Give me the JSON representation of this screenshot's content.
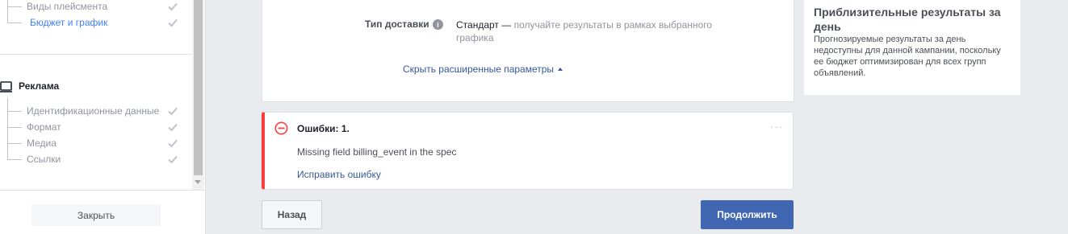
{
  "sidebar": {
    "campaign_items": [
      {
        "label": "Виды плейсмента",
        "active": false
      },
      {
        "label": "Бюджет и график",
        "active": true
      }
    ],
    "ad_section_title": "Реклама",
    "ad_items": [
      {
        "label": "Идентификационные данные"
      },
      {
        "label": "Формат"
      },
      {
        "label": "Медиа"
      },
      {
        "label": "Ссылки"
      }
    ],
    "close_label": "Закрыть"
  },
  "delivery": {
    "label": "Тип доставки",
    "value_main": "Стандарт —",
    "value_sub": "получайте результаты в рамках выбранного графика",
    "info_glyph": "i"
  },
  "hide_advanced_label": "Скрыть расширенные параметры",
  "error": {
    "title": "Ошибки: 1.",
    "message": "Missing field billing_event in the spec",
    "fix_label": "Исправить ошибку",
    "more_glyph": "···"
  },
  "footer": {
    "back_label": "Назад",
    "continue_label": "Продолжить"
  },
  "estimates": {
    "title": "Приблизительные результаты за день",
    "body": "Прогнозируемые результаты за день недоступны для данной кампании, поскольку ее бюджет оптимизирован для всех групп объявлений."
  },
  "colors": {
    "accent": "#4267b2",
    "link": "#365899",
    "error": "#fa3e3e",
    "active_nav": "#4080ff"
  }
}
